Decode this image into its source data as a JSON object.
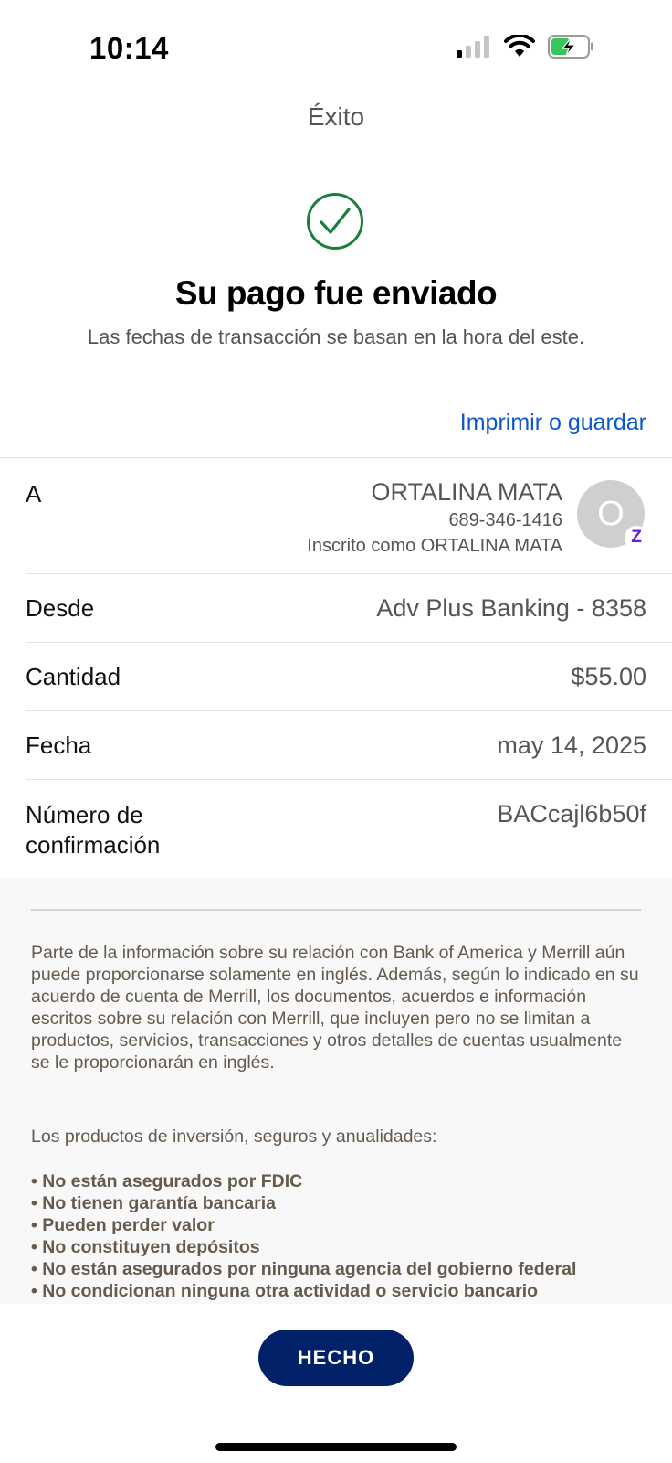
{
  "status_bar": {
    "time": "10:14",
    "icons": [
      "cellular-signal-icon",
      "wifi-icon",
      "battery-charging-icon"
    ]
  },
  "nav": {
    "title": "Éxito"
  },
  "success": {
    "icon": "check-circle-icon",
    "icon_color": "#1a7f37",
    "headline": "Su pago fue enviado",
    "subtitle": "Las fechas de transacción se basan en la hora del este."
  },
  "actions": {
    "print_label": "Imprimir o guardar",
    "link_color": "#0a58c9"
  },
  "details": {
    "to": {
      "label": "A",
      "name": "ORTALINA MATA",
      "phone": "689-346-1416",
      "enrolled": "Inscrito como ORTALINA MATA",
      "avatar_initial": "O",
      "badge": "zelle-icon",
      "badge_glyph": "Z"
    },
    "from": {
      "label": "Desde",
      "value": "Adv Plus Banking - 8358"
    },
    "amount": {
      "label": "Cantidad",
      "value": "$55.00"
    },
    "date": {
      "label": "Fecha",
      "value": "may 14, 2025"
    },
    "confirmation": {
      "label": "Número de confirmación",
      "value": "BACcajl6b50f"
    }
  },
  "disclosure": {
    "paragraph": "Parte de la información sobre su relación con Bank of America y Merrill aún puede proporcionarse solamente en inglés. Además, según lo indicado en su acuerdo de cuenta de Merrill, los documentos, acuerdos e información escritos sobre su relación con Merrill, que incluyen pero no se limitan a productos, servicios, transacciones y otros detalles de cuentas usualmente se le proporcionarán en inglés.",
    "intro": "Los productos de inversión, seguros y anualidades:",
    "bullets": [
      "• No están asegurados por FDIC",
      "• No tienen garantía bancaria",
      "• Pueden perder valor",
      "• No constituyen depósitos",
      "• No están asegurados por ninguna agencia del gobierno federal",
      "• No condicionan ninguna otra actividad o servicio bancario"
    ]
  },
  "footer": {
    "done_label": "HECHO",
    "button_color": "#012169"
  }
}
